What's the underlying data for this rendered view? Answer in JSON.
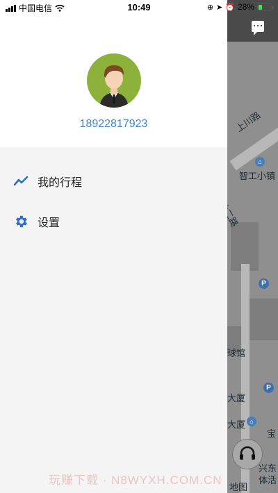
{
  "status_bar": {
    "carrier": "中国电信",
    "time": "10:49",
    "battery_percent": "28%",
    "battery_level": 0.28
  },
  "drawer": {
    "phone_number": "18922817923",
    "menu": [
      {
        "label": "我的行程",
        "icon": "trend-line-icon"
      },
      {
        "label": "设置",
        "icon": "gear-icon"
      }
    ]
  },
  "map": {
    "labels": [
      "上川路",
      "智工小镇",
      "智仙二路",
      "球馆",
      "大厦",
      "大厦",
      "宝",
      "兴东",
      "体活",
      "地图"
    ]
  },
  "watermark": "玩赚下载 · N8WYXH.COM.CN",
  "colors": {
    "accent": "#3f86c8",
    "icon": "#2f6fc9",
    "avatar_bg": "#8cb23b"
  }
}
